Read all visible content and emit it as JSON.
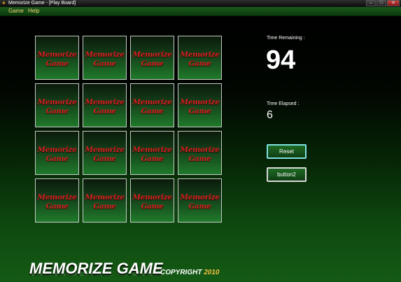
{
  "window": {
    "title": "Memorize Game - [Play Board]",
    "app_icon": "app-icon",
    "controls": [
      {
        "name": "minimize-button",
        "glyph": "–"
      },
      {
        "name": "maximize-button",
        "glyph": "□"
      },
      {
        "name": "close-button",
        "glyph": "✕"
      }
    ]
  },
  "menu": [
    "Game",
    "Help"
  ],
  "board": {
    "card_line1": "Memorize",
    "card_line2": "Game",
    "rows": 4,
    "cols": 4
  },
  "stats": {
    "time_remaining_label": "Time Remaining :",
    "time_remaining_value": "94",
    "time_elapsed_label": "Time Elapsed :",
    "time_elapsed_value": "6"
  },
  "buttons": {
    "reset": "Reset",
    "button2": "button2"
  },
  "footer": {
    "title": "MEMORIZE GAME",
    "copyright": "COPYRIGHT",
    "year": "2010"
  },
  "colors": {
    "card_text": "#d42020",
    "menu_text": "#f2d27a",
    "accent_green": "#145a14"
  }
}
